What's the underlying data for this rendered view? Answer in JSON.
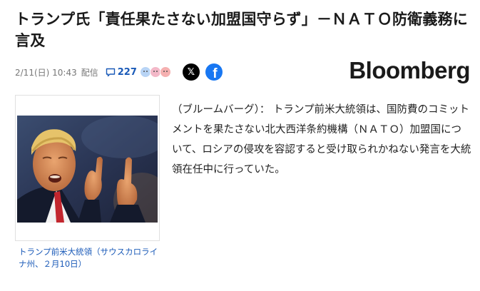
{
  "article": {
    "headline": "トランプ氏「責任果たさない加盟国守らず」－ＮＡＴＯ防衛義務に言及",
    "date": "2/11(日) 10:43",
    "source_label": "配信",
    "comment_count": "227",
    "brand": "Bloomberg",
    "photo_caption": "トランプ前米大統領（サウスカロライナ州、２月10日）",
    "body": "（ブルームバーグ）： トランプ前米大統領は、国防費のコミットメントを果たさない北大西洋条約機構（ＮＡＴＯ）加盟国について、ロシアの侵攻を容認すると受け取られかねない発言を大統領在任中に行っていた。"
  },
  "share": {
    "x_label": "𝕏",
    "facebook_label": "f"
  },
  "colors": {
    "link_blue": "#1a5ab8",
    "facebook_blue": "#1877f2"
  }
}
